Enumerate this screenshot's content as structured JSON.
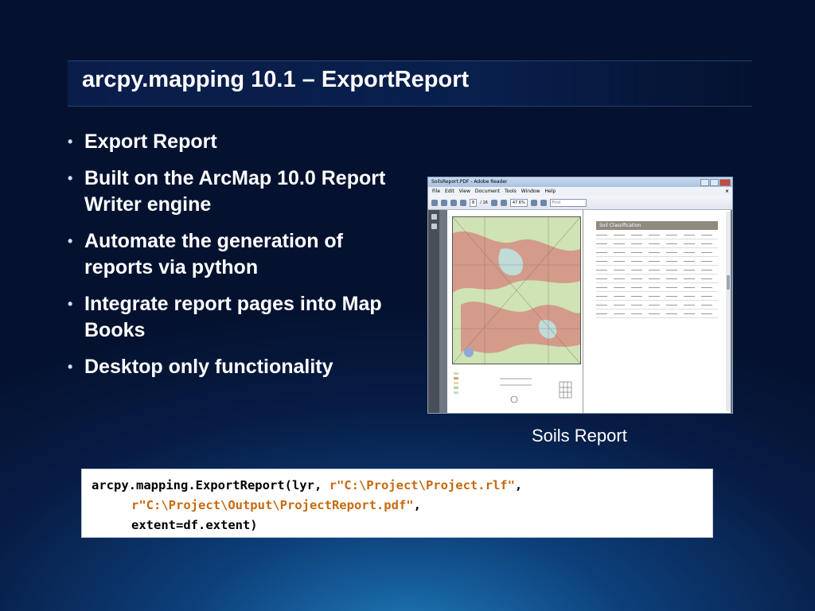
{
  "slide": {
    "title": "arcpy.mapping 10.1 – ExportReport",
    "bullets": [
      "Export Report",
      "Built on the ArcMap 10.0 Report Writer engine",
      "Automate the generation of reports via python",
      "Integrate report pages into Map Books",
      "Desktop only functionality"
    ],
    "caption": "Soils Report"
  },
  "reader": {
    "window_title": "SoilsReport.PDF - Adobe Reader",
    "menu": [
      "File",
      "Edit",
      "View",
      "Document",
      "Tools",
      "Window",
      "Help"
    ],
    "close_x": "×",
    "page_current": "8",
    "page_total": "/ 16",
    "zoom": "47.6%",
    "find_placeholder": "Find",
    "table_title": "Soil Classification"
  },
  "code": {
    "line1_prefix": "arcpy.mapping.ExportReport(lyr, ",
    "line1_string": "r\"C:\\Project\\Project.rlf\"",
    "line1_suffix": ",",
    "line2_string": "r\"C:\\Project\\Output\\ProjectReport.pdf\"",
    "line2_suffix": ",",
    "line3": "extent=df.extent)"
  },
  "colors": {
    "code_string": "#c66a10",
    "map_orange": "#d49b8a",
    "map_green": "#cfe3b4"
  }
}
